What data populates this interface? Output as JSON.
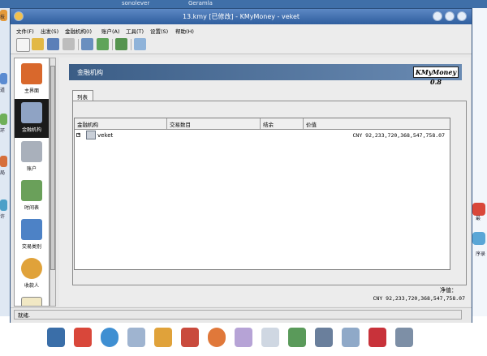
{
  "desktop": {
    "top_labels": [
      "sonolever",
      "Geramla"
    ],
    "left_labels": [
      "技",
      "道",
      "环",
      "局",
      "许"
    ],
    "right_labels": [
      "最",
      "序录"
    ]
  },
  "window": {
    "title": "13.kmy [已修改] - KMyMoney - veket",
    "buttons": [
      "minimize",
      "maximize",
      "close"
    ]
  },
  "menu": [
    "文件(F)",
    "出发(S)",
    "金融机构(I)",
    "账户(A)",
    "工具(T)",
    "设置(S)",
    "帮助(H)"
  ],
  "toolbar": {
    "icons": [
      "new-file-icon",
      "open-folder-icon",
      "save-icon",
      "print-icon",
      "web-icon",
      "qif-import-icon",
      "calculator-icon",
      "find-icon"
    ]
  },
  "nav": {
    "items": [
      {
        "label": "主界面",
        "icon": "home-icon",
        "color": "#d9682c"
      },
      {
        "label": "金融机构",
        "icon": "bank-icon",
        "color": "#8fa3c4"
      },
      {
        "label": "账户",
        "icon": "account-icon",
        "color": "#a9b0bb"
      },
      {
        "label": "时间表",
        "icon": "schedule-icon",
        "color": "#6aa05a"
      },
      {
        "label": "交易类别",
        "icon": "categories-icon",
        "color": "#4d82c6"
      },
      {
        "label": "收款人",
        "icon": "payees-icon",
        "color": "#e0a23a"
      }
    ],
    "selected_index": 1
  },
  "content": {
    "banner_title": "金融机构",
    "logo_text": "KMyMoney 0.8",
    "tab_label": "列表",
    "table": {
      "headers": [
        "金融机构",
        "交易数目",
        "结余",
        "价值"
      ],
      "rows": [
        {
          "name": "veket",
          "transactions": "",
          "balance": "",
          "value": "CNY 92,233,720,368,547,758.07"
        }
      ]
    },
    "net_worth_label": "净值：",
    "net_worth_value": "CNY 92,233,720,368,547,758.07"
  },
  "status": {
    "text": "就绪."
  },
  "dock": {
    "icons": [
      "system-icon",
      "first-aid-icon",
      "globe-icon",
      "pen-icon",
      "person-icon",
      "tools-icon",
      "browser-icon",
      "document-icon",
      "notepad-icon",
      "image-icon",
      "printer-icon",
      "list-icon",
      "gift-icon",
      "camera-icon"
    ]
  },
  "colors": {
    "title_bar": "#2f5e9e",
    "banner": "#3b5d86",
    "selected_nav": "#1a1a1a"
  }
}
